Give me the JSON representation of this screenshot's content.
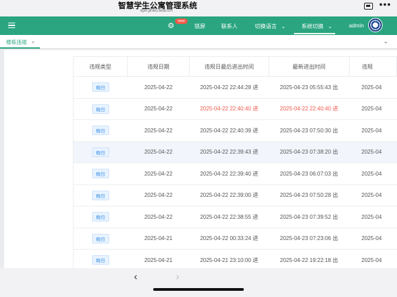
{
  "browser": {
    "site_title": "智慧学生公寓管理系统",
    "url": "vpn.jlnku.edu.cn",
    "tabs_icon": "tabs-icon",
    "more_label": "•••"
  },
  "nav": {
    "menu_icon": "hamburger-icon",
    "settings_icon": "gear-icon",
    "new_badge": "new",
    "lock_label": "锁屏",
    "contact_label": "联系人",
    "language_label": "切换语言",
    "system_label": "系统切换",
    "user_label": "admin",
    "caret": "⌄",
    "accent_color": "#2aa57f"
  },
  "tabbar": {
    "active_tab": "楼栋违规",
    "close_glyph": "×",
    "chevron": "⌄"
  },
  "table": {
    "headers": [
      "违规类型",
      "违规日期",
      "违规日最后进出时间",
      "最新进出时间",
      "违规"
    ],
    "rows": [
      {
        "type": "晚归",
        "date": "2025-04-22",
        "last": "2025-04-22 22:44:28 进",
        "latest": "2025-04-23 05:55:43 出",
        "extra": "2025-04"
      },
      {
        "type": "晚归",
        "date": "2025-04-22",
        "last": "2025-04-22 22:40:40 进",
        "latest": "2025-04-22 22:40:40 进",
        "extra": "2025-04"
      },
      {
        "type": "晚归",
        "date": "2025-04-22",
        "last": "2025-04-22 22:40:39 进",
        "latest": "2025-04-23 07:50:30 出",
        "extra": "2025-04"
      },
      {
        "type": "晚归",
        "date": "2025-04-22",
        "last": "2025-04-22 22:39:43 进",
        "latest": "2025-04-23 07:38:20 出",
        "extra": "2025-04"
      },
      {
        "type": "晚归",
        "date": "2025-04-22",
        "last": "2025-04-22 22:39:40 进",
        "latest": "2025-04-23 06:07:03 出",
        "extra": "2025-04"
      },
      {
        "type": "晚归",
        "date": "2025-04-22",
        "last": "2025-04-22 22:39:00 进",
        "latest": "2025-04-23 07:50:28 出",
        "extra": "2025-04"
      },
      {
        "type": "晚归",
        "date": "2025-04-22",
        "last": "2025-04-22 22:38:55 进",
        "latest": "2025-04-23 07:39:52 出",
        "extra": "2025-04"
      },
      {
        "type": "晚归",
        "date": "2025-04-21",
        "last": "2025-04-22 00:33:24 进",
        "latest": "2025-04-23 07:23:06 出",
        "extra": "2025-04"
      },
      {
        "type": "晚归",
        "date": "2025-04-21",
        "last": "2025-04-21 23:10:00 进",
        "latest": "2025-04-22 19:22:18 出",
        "extra": "2025-04"
      }
    ],
    "highlight_color": "#f05a4d"
  },
  "toolbar": {
    "back": "‹",
    "forward": "›"
  }
}
